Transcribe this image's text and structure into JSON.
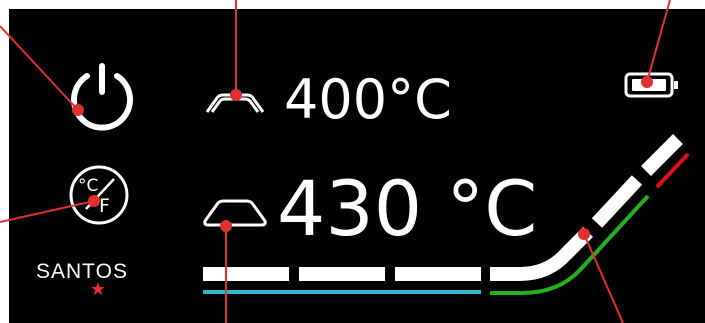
{
  "display": {
    "upper_temperature": "400°C",
    "lower_temperature": "430 °C",
    "brand": "SANTOS",
    "unit_toggle": {
      "celsius": "°C",
      "fahrenheit": "F"
    }
  },
  "icons": {
    "power": "power-icon",
    "unit_toggle": "celsius-fahrenheit-icon",
    "upper_element": "upper-heating-plate-icon",
    "lower_element": "lower-heating-plate-icon",
    "battery": "battery-icon",
    "brand_star": "star-icon"
  },
  "colors": {
    "background": "#000000",
    "text": "#ffffff",
    "annotation": "#e03030",
    "progress_track": "#ffffff",
    "cyan_line": "#2fb6c8",
    "green_line": "#22b022",
    "red_line": "#e01010"
  }
}
